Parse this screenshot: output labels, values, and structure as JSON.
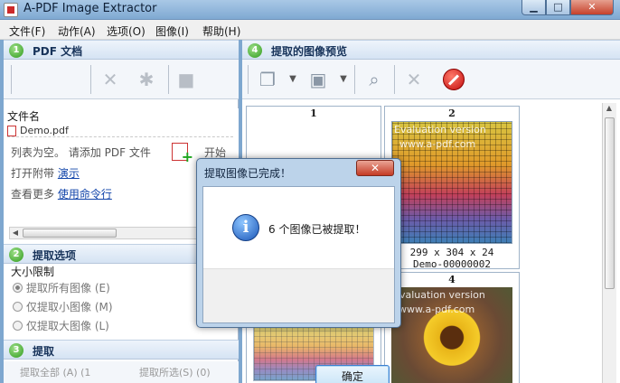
{
  "window": {
    "title": "A-PDF Image Extractor",
    "controls": {
      "minimize": "▁",
      "maximize": "□",
      "close": "✕"
    }
  },
  "menu": [
    "文件(F)",
    "动作(A)",
    "选项(O)",
    "图像(I)",
    "帮助(H)"
  ],
  "left": {
    "sections": [
      {
        "num": "1",
        "title": "PDF 文档"
      },
      {
        "num": "2",
        "title": "提取选项"
      },
      {
        "num": "3",
        "title": "提取"
      }
    ],
    "file_list": {
      "column_header": "文件名",
      "files": [
        "Demo.pdf"
      ],
      "empty_prefix": "列表为空。 请添加 PDF 文件",
      "start_label": "开始",
      "attach_prefix": "打开附带",
      "demo_link": "演示",
      "more_prefix": "查看更多",
      "cmdline_link": "使用命令行"
    },
    "options": {
      "group_label": "大小限制",
      "radios": [
        {
          "label": "提取所有图像 (E)",
          "checked": true
        },
        {
          "label": "仅提取小图像 (M)",
          "checked": false
        },
        {
          "label": "仅提取大图像 (L)",
          "checked": false
        }
      ]
    },
    "extract": {
      "all_button": "提取全部 (A) (1",
      "selected_button": "提取所选(S) (0)"
    }
  },
  "right": {
    "section": {
      "num": "4",
      "title": "提取的图像预览"
    },
    "thumbnails": [
      {
        "num": "1"
      },
      {
        "num": "2",
        "watermark1": "Evaluation version",
        "watermark2": "www.a-pdf.com",
        "dims": "299 x 304 x 24",
        "name": "Demo-00000002"
      },
      {
        "num": "4",
        "watermark1": "Evaluation version",
        "watermark2": "www.a-pdf.com"
      }
    ]
  },
  "dialog": {
    "title": "提取图像已完成！",
    "close": "✕",
    "message": "6 个图像已被提取！",
    "ok": "确定"
  },
  "colors": {
    "accent": "#3b7fd0",
    "header_green": "#2f9a1c",
    "stop_red": "#c30e0e"
  }
}
